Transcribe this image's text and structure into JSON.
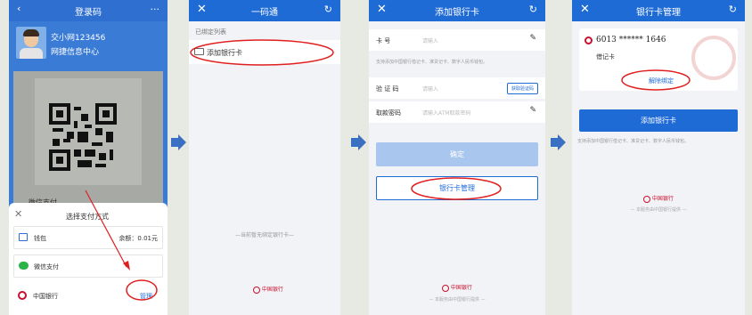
{
  "p1": {
    "header_title": "登录码",
    "user_name": "交小网123456",
    "user_center": "网捷信息中心",
    "wechat_under": "微信支付",
    "sheet_title": "选择支付方式",
    "wallet_label": "钱包",
    "wallet_balance": "余额：0.01元",
    "wechat_label": "微信支付",
    "boc_label": "中国银行",
    "manage_label": "管理"
  },
  "p2": {
    "title": "一码通",
    "bound_list": "已绑定列表",
    "add_card": "添加银行卡",
    "no_card": "—当前暂无绑定银行卡—"
  },
  "p3": {
    "title": "添加银行卡",
    "card_no_label": "卡 号",
    "card_no_ph": "请输入",
    "support_note": "支持添加中国银行借记卡、准贷记卡、数字人民币钱包。",
    "code_label": "验 证 码",
    "code_ph": "请输入",
    "get_code": "获取验证码",
    "pwd_label": "取款密码",
    "pwd_ph": "请输入ATM取款密码",
    "confirm": "确定",
    "manage": "银行卡管理",
    "footer": "— 本服务由中国银行提供 —"
  },
  "p4": {
    "title": "银行卡管理",
    "card_number": "6013 ****** 1646",
    "card_type": "借记卡",
    "unbind": "解除绑定",
    "add_card": "添加银行卡",
    "support_note": "支持添加中国银行借记卡、准贷记卡、数字人民币钱包。",
    "footer": "— 本服务由中国银行提供 —"
  },
  "boc_logo_text": "中国银行",
  "colors": {
    "blue": "#1f6bd6",
    "red": "#e02020",
    "boc": "#c8102e",
    "arrow": "#3b6fc4"
  }
}
